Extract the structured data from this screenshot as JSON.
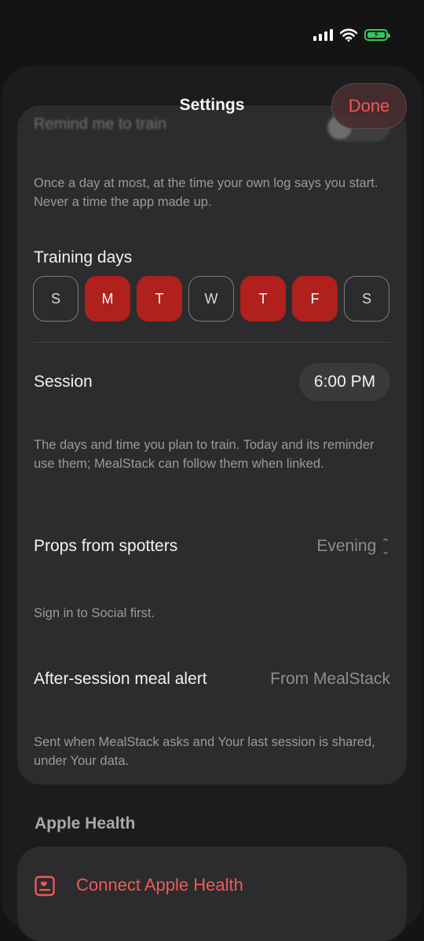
{
  "status_bar": {
    "signal_icon": "cellular-signal-icon",
    "wifi_icon": "wifi-icon",
    "battery_icon": "battery-charging-icon",
    "battery_color": "#34c759"
  },
  "nav": {
    "title": "Settings",
    "done_label": "Done"
  },
  "reminder": {
    "label": "Remind me to train",
    "footnote": "Once a day at most, at the time your own log says you start. Never a time the app made up."
  },
  "training_days": {
    "label": "Training days",
    "days": [
      {
        "letter": "S",
        "selected": false
      },
      {
        "letter": "M",
        "selected": true
      },
      {
        "letter": "T",
        "selected": true
      },
      {
        "letter": "W",
        "selected": false
      },
      {
        "letter": "T",
        "selected": true
      },
      {
        "letter": "F",
        "selected": true
      },
      {
        "letter": "S",
        "selected": false
      }
    ]
  },
  "session": {
    "label": "Session",
    "time": "6:00 PM",
    "footnote": "The days and time you plan to train. Today and its reminder use them; MealStack can follow them when linked."
  },
  "props": {
    "label": "Props from spotters",
    "value": "Evening",
    "footnote": "Sign in to Social first."
  },
  "meal_alert": {
    "label": "After-session meal alert",
    "value": "From MealStack",
    "footnote": "Sent when MealStack asks and Your last session is shared, under Your data."
  },
  "apple_health": {
    "section_title": "Apple Health",
    "connect_label": "Connect Apple Health",
    "icon": "health-card-icon"
  },
  "colors": {
    "accent": "#ef5a55",
    "selected_day": "#b0201d",
    "sheet": "#1c1c1e",
    "card": "#2c2c2e"
  }
}
